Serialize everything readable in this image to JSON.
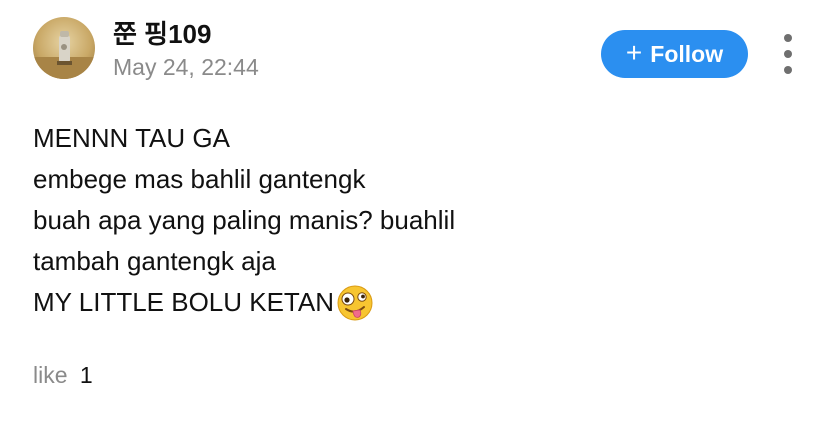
{
  "author": {
    "username": "쭌 핑109",
    "timestamp": "May 24, 22:44"
  },
  "actions": {
    "follow_label": "Follow",
    "follow_icon": "plus-icon",
    "more_icon": "more-vertical-icon"
  },
  "post": {
    "lines": [
      "MENNN TAU GA",
      "embege mas bahlil gantengk",
      "buah apa yang paling manis? buahlil",
      "tambah gantengk aja",
      "MY LITTLE BOLU KETAN"
    ],
    "emoji": "zany-face-emoji"
  },
  "reactions": {
    "like_label": "like",
    "like_count": "1"
  },
  "colors": {
    "accent": "#2b8ff0",
    "muted_text": "#8a8a8a",
    "body_text": "#111111"
  }
}
